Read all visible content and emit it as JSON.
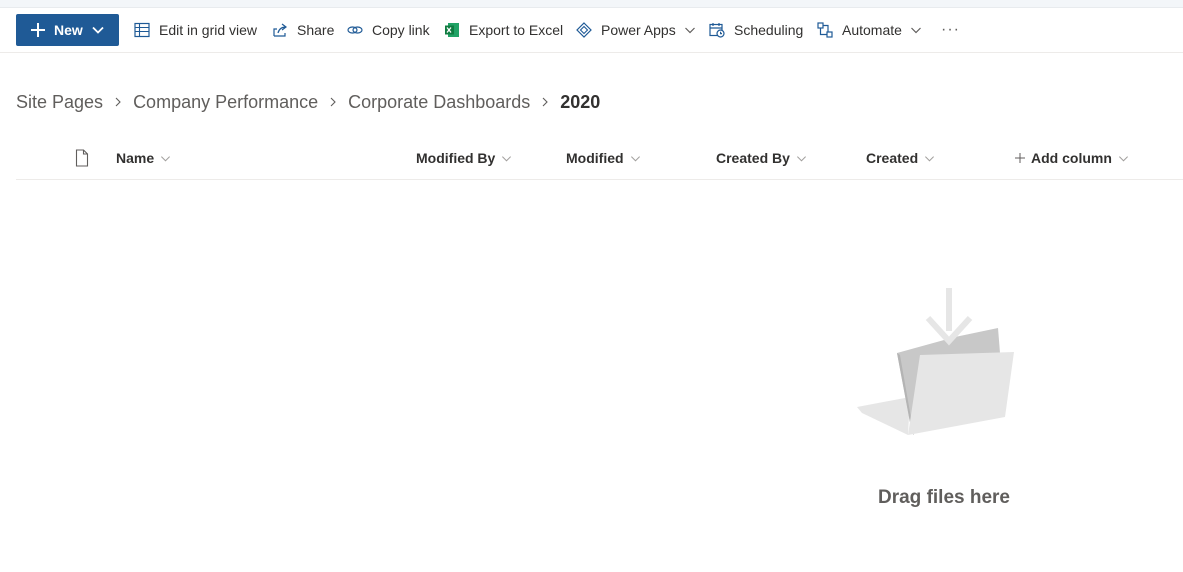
{
  "commandbar": {
    "new_label": "New",
    "items": [
      {
        "label": "Edit in grid view",
        "icon": "grid-icon"
      },
      {
        "label": "Share",
        "icon": "share-icon"
      },
      {
        "label": "Copy link",
        "icon": "link-icon"
      },
      {
        "label": "Export to Excel",
        "icon": "excel-icon"
      },
      {
        "label": "Power Apps",
        "icon": "powerapps-icon"
      },
      {
        "label": "Scheduling",
        "icon": "calendar-clock-icon"
      },
      {
        "label": "Automate",
        "icon": "flow-icon"
      }
    ],
    "more_label": "···"
  },
  "breadcrumb": {
    "items": [
      "Site Pages",
      "Company Performance",
      "Corporate Dashboards"
    ],
    "current": "2020"
  },
  "columns": {
    "name": "Name",
    "modified_by": "Modified By",
    "modified": "Modified",
    "created_by": "Created By",
    "created": "Created",
    "add_column": "Add column"
  },
  "empty_state": {
    "message": "Drag files here"
  },
  "colors": {
    "primary": "#1f5a96",
    "excel": "#107c41"
  }
}
